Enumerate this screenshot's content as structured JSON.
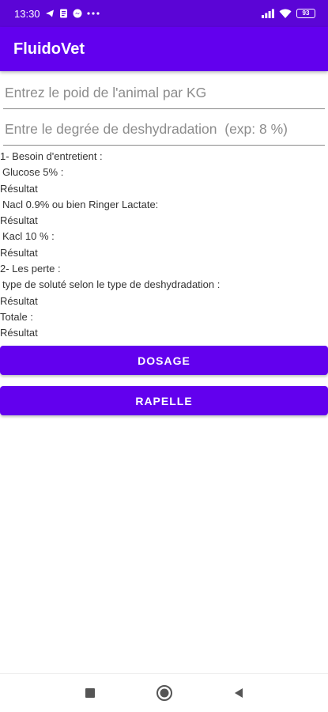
{
  "status_bar": {
    "time": "13:30",
    "battery": "93",
    "icons": [
      "telegram-icon",
      "document-icon",
      "messenger-icon",
      "more-dots-icon",
      "signal-icon",
      "wifi-icon",
      "battery-icon"
    ]
  },
  "app": {
    "title": "FluidoVet"
  },
  "form": {
    "weight_placeholder": "Entrez le poid de l'animal par KG",
    "weight_value": "",
    "dehydration_placeholder": "Entre le degrée de deshydradation  (exp: 8 %)",
    "dehydration_value": ""
  },
  "results": {
    "besoin_label": "1- Besoin d'entretient :",
    "glucose_label": " Glucose 5% :",
    "glucose_result": "Résultat",
    "nacl_label": " Nacl 0.9% ou bien Ringer Lactate:",
    "nacl_result": "Résultat",
    "kacl_label": " Kacl 10 % :",
    "kacl_result": "Résultat",
    "perte_label": "2- Les perte :",
    "solute_label": " type de soluté selon le type de deshydradation :",
    "solute_result": "Résultat",
    "totale_label": "Totale :",
    "totale_result": "Résultat"
  },
  "buttons": {
    "dosage": "DOSAGE",
    "rapelle": "RAPELLE"
  },
  "nav": {
    "icons": [
      "recents-square-icon",
      "home-circle-icon",
      "back-triangle-icon"
    ]
  },
  "colors": {
    "primary": "#6200ee",
    "status_bar": "#5b05d6",
    "background": "#ffffff"
  }
}
